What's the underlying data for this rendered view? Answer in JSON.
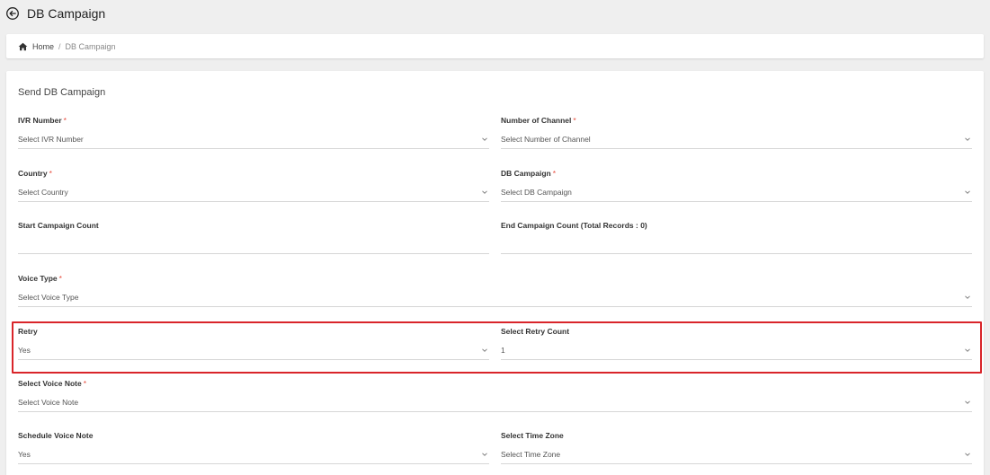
{
  "header": {
    "title": "DB Campaign"
  },
  "breadcrumb": {
    "home": "Home",
    "separator": "/",
    "current": "DB Campaign"
  },
  "form": {
    "title": "Send DB Campaign",
    "fields": {
      "ivr_number": {
        "label": "IVR Number",
        "required": "*",
        "placeholder": "Select IVR Number"
      },
      "number_of_channel": {
        "label": "Number of Channel",
        "required": "*",
        "placeholder": "Select Number of Channel"
      },
      "country": {
        "label": "Country",
        "required": "*",
        "placeholder": "Select Country"
      },
      "db_campaign": {
        "label": "DB Campaign",
        "required": "*",
        "placeholder": "Select DB Campaign"
      },
      "start_campaign_count": {
        "label": "Start Campaign Count",
        "value": ""
      },
      "end_campaign_count": {
        "label": "End Campaign Count (Total Records : 0)",
        "value": ""
      },
      "voice_type": {
        "label": "Voice Type",
        "required": "*",
        "placeholder": "Select Voice Type"
      },
      "retry": {
        "label": "Retry",
        "value": "Yes"
      },
      "retry_count": {
        "label": "Select Retry Count",
        "value": "1"
      },
      "voice_note": {
        "label": "Select Voice Note",
        "required": "*",
        "placeholder": "Select Voice Note"
      },
      "schedule_voice_note": {
        "label": "Schedule Voice Note",
        "value": "Yes"
      },
      "time_zone": {
        "label": "Select Time Zone",
        "placeholder": "Select Time Zone"
      }
    }
  },
  "colors": {
    "required": "#e74c3c",
    "highlight": "#d9252a",
    "background": "#efefef"
  }
}
